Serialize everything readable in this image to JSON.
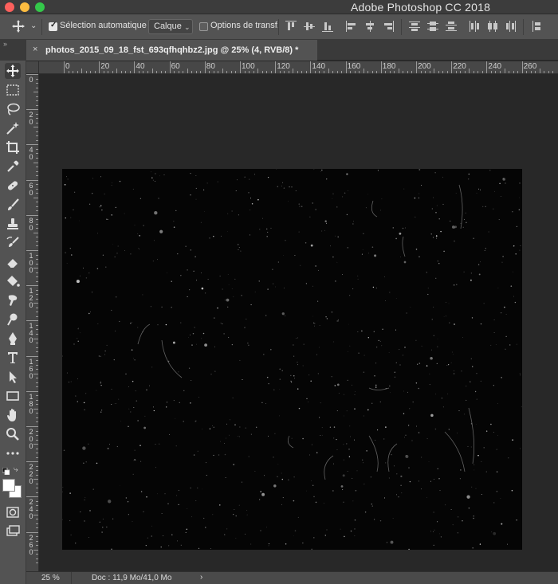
{
  "window": {
    "app_title": "Adobe Photoshop CC 2018"
  },
  "options_bar": {
    "auto_select_label": "Sélection automatique :",
    "auto_select_checked": true,
    "auto_select_target": "Calque",
    "transform_options_label": "Options de transf.",
    "transform_options_checked": false
  },
  "document": {
    "tab_title": "photos_2015_09_18_fst_693qfhqhbz2.jpg @ 25% (4, RVB/8) *",
    "close_glyph": "×"
  },
  "ruler": {
    "horizontal_labels": [
      "0",
      "20",
      "40",
      "60",
      "80",
      "100",
      "120",
      "140",
      "160",
      "180",
      "200",
      "220",
      "240",
      "260"
    ],
    "vertical_labels": [
      "0",
      "20",
      "40",
      "60",
      "80",
      "100",
      "120",
      "140",
      "160",
      "180",
      "200",
      "220",
      "240",
      "260"
    ]
  },
  "status_bar": {
    "zoom": "25 %",
    "doc_info": "Doc : 11,9 Mo/41,0 Mo",
    "arrow": "›"
  },
  "colors": {
    "foreground": "#ffffff",
    "background": "#ffffff",
    "ui_panel": "#535353",
    "canvas_bg": "#282828"
  },
  "icons": [
    "move-icon",
    "marquee-icon",
    "lasso-icon",
    "magic-wand-icon",
    "crop-icon",
    "eyedropper-icon",
    "healing-brush-icon",
    "brush-icon",
    "stamp-icon",
    "history-brush-icon",
    "eraser-icon",
    "paint-bucket-icon",
    "smudge-icon",
    "dodge-icon",
    "pen-icon",
    "type-icon",
    "path-select-icon",
    "rectangle-icon",
    "hand-icon",
    "zoom-icon",
    "more-tools-icon",
    "quick-mask-icon",
    "screen-mode-icon"
  ]
}
